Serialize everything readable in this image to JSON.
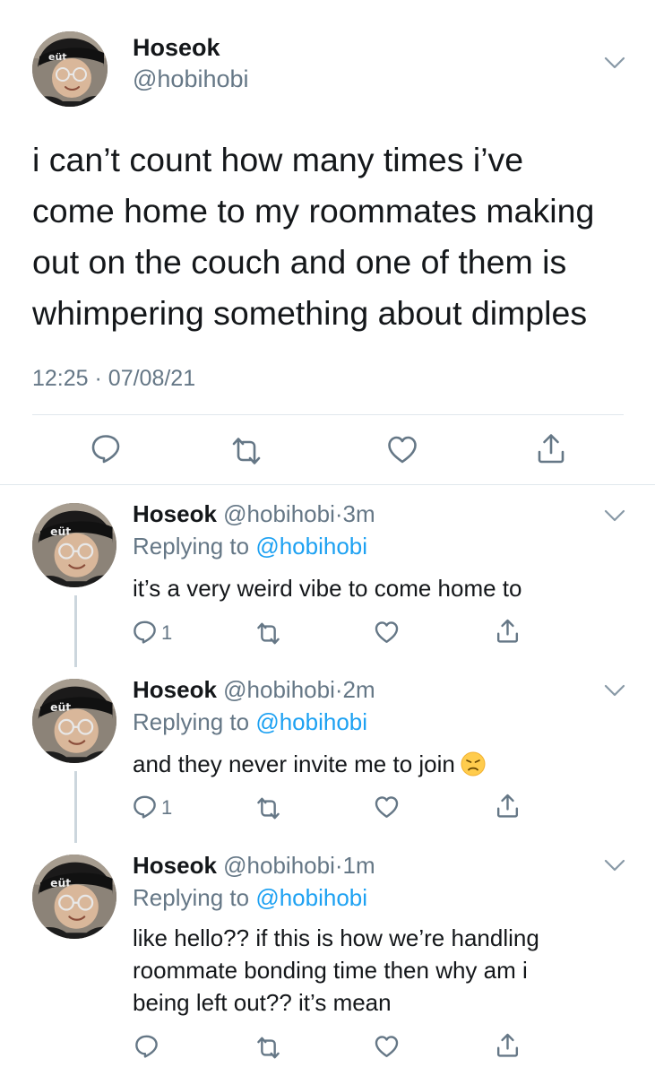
{
  "main_tweet": {
    "name": "Hoseok",
    "handle": "@hobihobi",
    "text_lines": [
      "i can’t count how many times i’ve",
      "come home to my roommates making",
      "out on the couch and one of them is",
      "whimpering something about dimples"
    ],
    "time": "12:25",
    "separator": "·",
    "date": "07/08/21",
    "actions": [
      "reply-icon",
      "retweet-icon",
      "like-icon",
      "share-icon"
    ]
  },
  "replies": [
    {
      "name": "Hoseok",
      "handle": "@hobihobi",
      "dot": "·",
      "time": "3m",
      "replying_label": "Replying to",
      "replying_to": "@hobihobi",
      "text_lines": [
        "it’s a very weird vibe to come home to"
      ],
      "reply_count": "1"
    },
    {
      "name": "Hoseok",
      "handle": "@hobihobi",
      "dot": "·",
      "time": "2m",
      "replying_label": "Replying to",
      "replying_to": "@hobihobi",
      "text_lines": [
        "and they never invite me to join"
      ],
      "emoji": "disappointed-face",
      "reply_count": "1"
    },
    {
      "name": "Hoseok",
      "handle": "@hobihobi",
      "dot": "·",
      "time": "1m",
      "replying_label": "Replying to",
      "replying_to": "@hobihobi",
      "text_lines": [
        "like hello?? if this is how we’re handling",
        "roommate bonding time then why am i",
        "being left out?? it’s mean"
      ],
      "reply_count": ""
    }
  ],
  "colors": {
    "text": "#14171a",
    "secondary": "#657786",
    "link": "#1da1f2",
    "divider": "#e1e8ed",
    "thread_line": "#ccd6dd"
  }
}
